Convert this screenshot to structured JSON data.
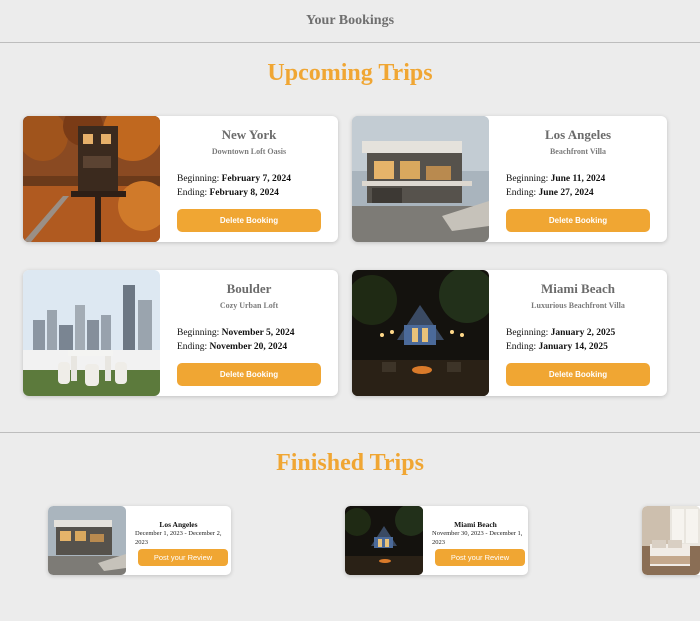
{
  "header": {
    "title": "Your Bookings"
  },
  "upcoming": {
    "title": "Upcoming Trips",
    "trips": [
      {
        "place": "New York",
        "name": "Downtown Loft Oasis",
        "begin_label": "Beginning:",
        "begin": "February 7, 2024",
        "end_label": "Ending:",
        "end": "February 8, 2024",
        "button": "Delete Booking"
      },
      {
        "place": "Los Angeles",
        "name": "Beachfront Villa",
        "begin_label": "Beginning:",
        "begin": "June 11, 2024",
        "end_label": "Ending:",
        "end": "June 27, 2024",
        "button": "Delete Booking"
      },
      {
        "place": "Boulder",
        "name": "Cozy Urban Loft",
        "begin_label": "Beginning:",
        "begin": "November 5, 2024",
        "end_label": "Ending:",
        "end": "November 20, 2024",
        "button": "Delete Booking"
      },
      {
        "place": "Miami Beach",
        "name": "Luxurious Beachfront Villa",
        "begin_label": "Beginning:",
        "begin": "January 2, 2025",
        "end_label": "Ending:",
        "end": "January 14, 2025",
        "button": "Delete Booking"
      }
    ]
  },
  "finished": {
    "title": "Finished Trips",
    "trips": [
      {
        "place": "Los Angeles",
        "dates_line1": "December 1, 2023 - December 2,",
        "dates_line2": "2023",
        "button": "Post your Review"
      },
      {
        "place": "Miami Beach",
        "dates_line1": "November 30, 2023 - December 1,",
        "dates_line2": "2023",
        "button": "Post your Review"
      }
    ]
  },
  "colors": {
    "accent": "#f0a633",
    "background": "#ececec"
  }
}
